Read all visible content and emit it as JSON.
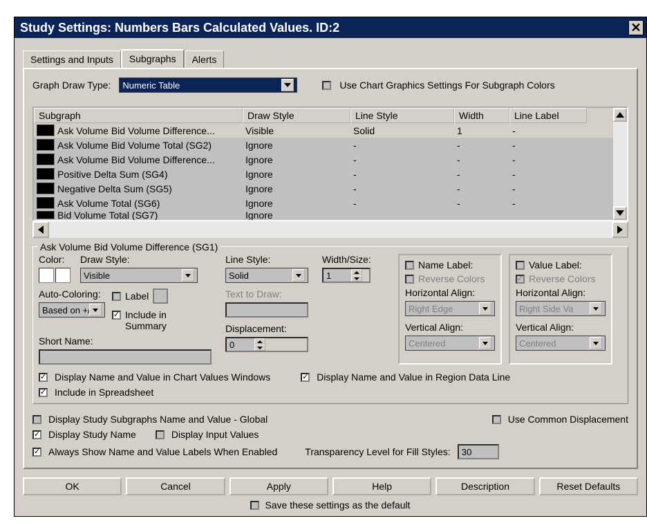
{
  "titlebar": {
    "title": "Study Settings: Numbers Bars Calculated Values. ID:2"
  },
  "tabs": [
    "Settings and Inputs",
    "Subgraphs",
    "Alerts"
  ],
  "active_tab": 1,
  "graph_draw_type_label": "Graph Draw Type:",
  "graph_draw_type_value": "Numeric Table",
  "use_chart_graphics_label": "Use Chart Graphics Settings For Subgraph Colors",
  "table": {
    "headers": [
      "Subgraph",
      "Draw Style",
      "Line Style",
      "Width",
      "Line Label"
    ],
    "rows": [
      {
        "name": "Ask Volume Bid Volume Difference...",
        "draw": "Visible",
        "line": "Solid",
        "width": "1",
        "label": "-",
        "light": true
      },
      {
        "name": "Ask Volume Bid Volume Total (SG2)",
        "draw": "Ignore",
        "line": "-",
        "width": "-",
        "label": "-",
        "light": false
      },
      {
        "name": "Ask Volume Bid Volume Difference...",
        "draw": "Ignore",
        "line": "-",
        "width": "-",
        "label": "-",
        "light": false
      },
      {
        "name": "Positive Delta Sum (SG4)",
        "draw": "Ignore",
        "line": "-",
        "width": "-",
        "label": "-",
        "light": false
      },
      {
        "name": "Negative Delta Sum (SG5)",
        "draw": "Ignore",
        "line": "-",
        "width": "-",
        "label": "-",
        "light": false
      },
      {
        "name": "Ask Volume Total (SG6)",
        "draw": "Ignore",
        "line": "-",
        "width": "-",
        "label": "-",
        "light": false
      },
      {
        "name": "Bid Volume Total (SG7)",
        "draw": "Ignore",
        "line": "-",
        "width": "-",
        "label": "-",
        "light": false
      }
    ]
  },
  "detail": {
    "legend": "Ask Volume Bid Volume Difference (SG1)",
    "color_label": "Color:",
    "draw_style_label": "Draw Style:",
    "draw_style_value": "Visible",
    "line_style_label": "Line Style:",
    "line_style_value": "Solid",
    "width_label": "Width/Size:",
    "width_value": "1",
    "auto_coloring_label": "Auto-Coloring:",
    "auto_coloring_value": "Based on +/-",
    "label_cb": "Label",
    "include_summary_cb": "Include in Summary",
    "short_name_label": "Short Name:",
    "short_name_value": "",
    "text_to_draw_label": "Text to Draw:",
    "text_to_draw_value": "",
    "displacement_label": "Displacement:",
    "displacement_value": "0",
    "name_label_cb": "Name Label:",
    "name_reverse_colors": "Reverse Colors",
    "name_halign_label": "Horizontal Align:",
    "name_halign_value": "Right Edge",
    "name_valign_label": "Vertical Align:",
    "name_valign_value": "Centered",
    "value_label_cb": "Value Label:",
    "value_reverse_colors": "Reverse Colors",
    "value_halign_label": "Horizontal Align:",
    "value_halign_value": "Right Side Va",
    "value_valign_label": "Vertical Align:",
    "value_valign_value": "Centered",
    "display_cvw": "Display Name and Value in Chart Values Windows",
    "display_rdl": "Display Name and Value in Region Data Line",
    "include_spreadsheet": "Include in Spreadsheet"
  },
  "global": {
    "display_global": "Display Study Subgraphs Name and Value - Global",
    "use_common_disp": "Use Common Displacement",
    "display_study_name": "Display Study Name",
    "display_input_values": "Display Input Values",
    "always_show": "Always Show Name and Value Labels When Enabled",
    "transparency_label": "Transparency Level for Fill Styles:",
    "transparency_value": "30"
  },
  "buttons": [
    "OK",
    "Cancel",
    "Apply",
    "Help",
    "Description",
    "Reset Defaults"
  ],
  "save_default": "Save these settings as the default"
}
